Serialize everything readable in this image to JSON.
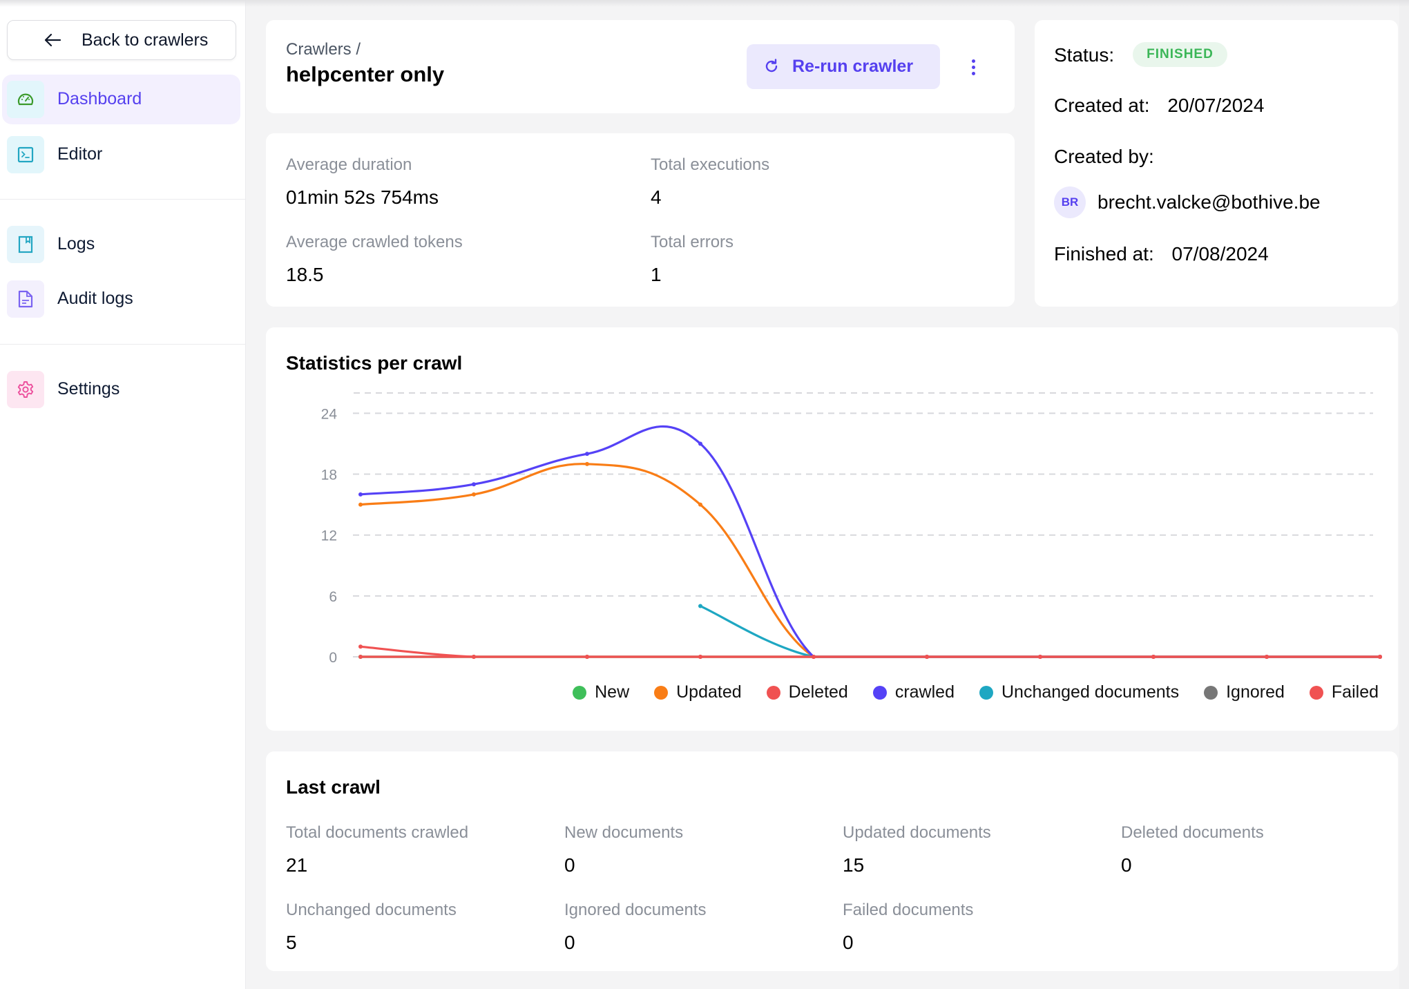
{
  "sidebar": {
    "back_label": "Back to crawlers",
    "items": [
      {
        "label": "Dashboard",
        "icon": "dashboard-gauge-icon",
        "active": true
      },
      {
        "label": "Editor",
        "icon": "terminal-icon",
        "active": false
      },
      {
        "label": "Logs",
        "icon": "book-icon",
        "active": false
      },
      {
        "label": "Audit logs",
        "icon": "document-icon",
        "active": false
      },
      {
        "label": "Settings",
        "icon": "gear-icon",
        "active": false
      }
    ]
  },
  "header": {
    "breadcrumb": "Crawlers /",
    "title": "helpcenter only",
    "rerun_label": "Re-run crawler",
    "rerun_icon": "refresh-icon",
    "more_icon": "kebab-menu-icon"
  },
  "stats": {
    "avg_duration_label": "Average duration",
    "avg_duration_value": "01min 52s 754ms",
    "total_executions_label": "Total executions",
    "total_executions_value": "4",
    "avg_tokens_label": "Average crawled tokens",
    "avg_tokens_value": "18.5",
    "total_errors_label": "Total errors",
    "total_errors_value": "1"
  },
  "status": {
    "status_label": "Status:",
    "status_value": "FINISHED",
    "created_at_label": "Created at:",
    "created_at_value": "20/07/2024",
    "created_by_label": "Created by:",
    "avatar_initials": "BR",
    "created_by_value": "brecht.valcke@bothive.be",
    "finished_at_label": "Finished at:",
    "finished_at_value": "07/08/2024",
    "badge_color": "#3bb657"
  },
  "chart_data": {
    "type": "line",
    "title": "Statistics per crawl",
    "xlabel": "",
    "ylabel": "",
    "x": [
      0,
      1,
      2,
      3,
      4,
      5,
      6,
      7,
      8,
      9
    ],
    "ylim": [
      0,
      26
    ],
    "yticks": [
      0,
      6,
      12,
      18,
      24
    ],
    "grid": true,
    "legend_position": "bottom-right",
    "series": [
      {
        "name": "New",
        "color": "#3fbf5a",
        "values": [
          0,
          0,
          0,
          0,
          0,
          0,
          0,
          0,
          0,
          0
        ]
      },
      {
        "name": "Updated",
        "color": "#f97d16",
        "values": [
          15,
          16,
          19,
          15,
          0,
          0,
          0,
          0,
          0,
          0
        ]
      },
      {
        "name": "Deleted",
        "color": "#f05252",
        "values": [
          0,
          0,
          0,
          0,
          0,
          0,
          0,
          0,
          0,
          0
        ]
      },
      {
        "name": "crawled",
        "color": "#5542f6",
        "values": [
          16,
          17,
          20,
          21,
          0,
          0,
          0,
          0,
          0,
          0
        ]
      },
      {
        "name": "Unchanged documents",
        "color": "#1ea7c2",
        "values": [
          null,
          null,
          null,
          5,
          0,
          0,
          0,
          0,
          0,
          0
        ]
      },
      {
        "name": "Ignored",
        "color": "#777777",
        "values": [
          0,
          0,
          0,
          0,
          0,
          0,
          0,
          0,
          0,
          0
        ]
      },
      {
        "name": "Failed",
        "color": "#f05252",
        "values": [
          1,
          0,
          0,
          0,
          0,
          0,
          0,
          0,
          0,
          0
        ]
      }
    ]
  },
  "last_crawl": {
    "title": "Last crawl",
    "items": [
      {
        "label": "Total documents crawled",
        "value": "21"
      },
      {
        "label": "New documents",
        "value": "0"
      },
      {
        "label": "Updated documents",
        "value": "15"
      },
      {
        "label": "Deleted documents",
        "value": "0"
      },
      {
        "label": "Unchanged documents",
        "value": "5"
      },
      {
        "label": "Ignored documents",
        "value": "0"
      },
      {
        "label": "Failed documents",
        "value": "0"
      }
    ]
  },
  "colors": {
    "accent": "#5540ef",
    "accent_bg": "#ebe9fd",
    "page_bg": "#f4f4f5"
  }
}
